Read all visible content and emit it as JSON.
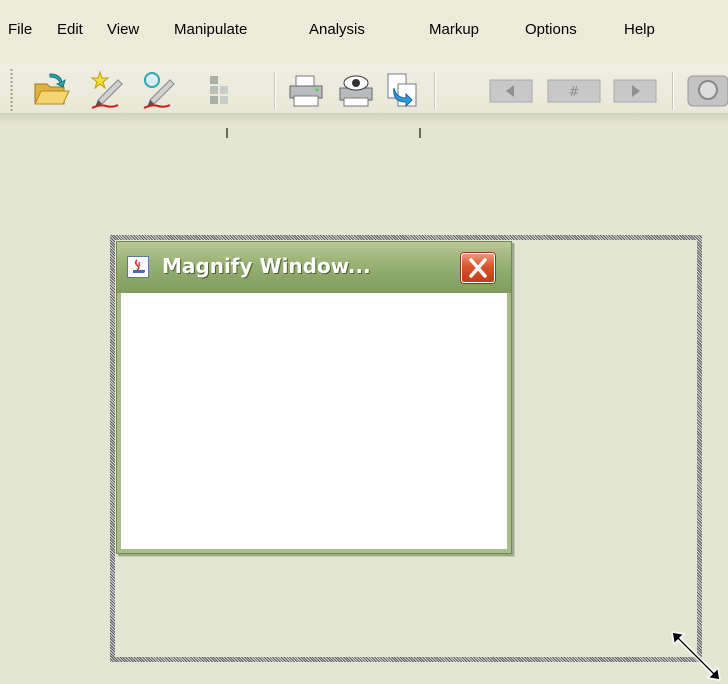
{
  "menubar": {
    "items": [
      "File",
      "Edit",
      "View",
      "Manipulate",
      "Analysis",
      "Markup",
      "Options",
      "Help"
    ]
  },
  "toolbar": {
    "buttons": [
      "open-folder-icon",
      "edit-star-icon",
      "edit-annotate-icon",
      "tree-hierarchy-icon",
      "print-icon",
      "print-preview-icon",
      "export-document-icon",
      "previous-page-icon",
      "page-number-icon",
      "next-page-icon",
      "magnify-icon"
    ]
  },
  "magnify_window": {
    "title": "Magnify Window..."
  },
  "colors": {
    "desktop_bg": "#e3e6d2",
    "titlebar": "#8ea86b",
    "close_button": "#d9542c"
  }
}
